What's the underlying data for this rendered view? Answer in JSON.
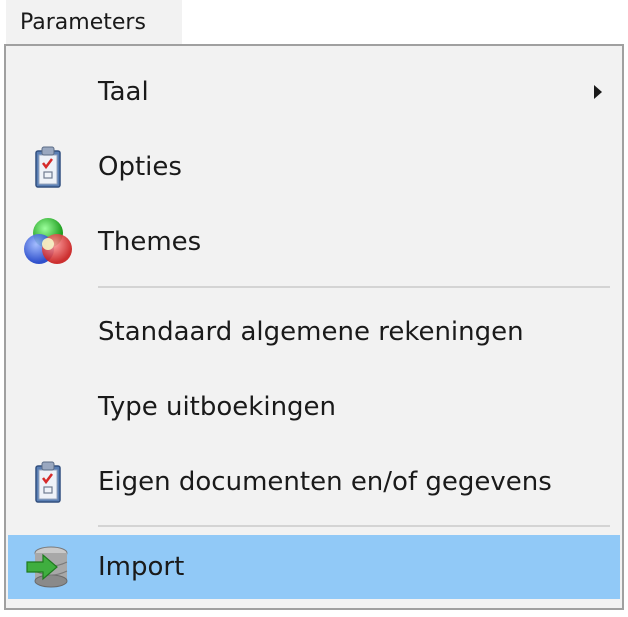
{
  "menubar": {
    "title": "Parameters"
  },
  "menu": {
    "items": [
      {
        "label": "Taal",
        "icon": null,
        "submenu": true
      },
      {
        "label": "Opties",
        "icon": "clipboard-check-icon"
      },
      {
        "label": "Themes",
        "icon": "color-circles-icon"
      },
      {
        "label": "Standaard algemene rekeningen",
        "icon": null
      },
      {
        "label": "Type uitboekingen",
        "icon": null
      },
      {
        "label": "Eigen documenten en/of gegevens",
        "icon": "clipboard-check-icon"
      },
      {
        "label": "Import",
        "icon": "database-import-icon",
        "highlighted": true
      }
    ]
  },
  "colors": {
    "menu_background": "#f2f2f2",
    "highlight": "#91c9f7",
    "border": "#a0a0a0",
    "separator": "#d4d4d4"
  }
}
